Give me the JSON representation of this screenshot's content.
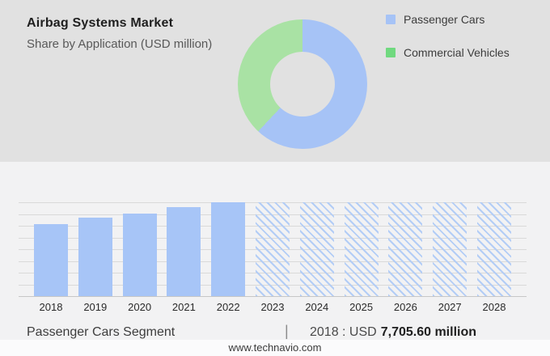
{
  "header": {
    "title": "Airbag Systems Market",
    "subtitle": "Share by Application (USD million)"
  },
  "legend": {
    "items": [
      {
        "label": "Passenger Cars",
        "color": "#a6c3f6"
      },
      {
        "label": "Commercial Vehicles",
        "color": "#70d97f"
      }
    ]
  },
  "footer": {
    "segment_label": "Passenger Cars Segment",
    "divider": "|",
    "value_prefix": "2018 : USD",
    "value_bold": "7,705.60 million",
    "website": "www.technavio.com"
  },
  "colors": {
    "banner_bg": "#e1e1e1",
    "section_bg": "#f2f2f3",
    "bar_blue": "#a7c5f7",
    "hatch_blue": "#b3cdf6",
    "gridline": "#d9d9d9"
  },
  "chart_data": [
    {
      "type": "pie",
      "donut": true,
      "title": "Share by Application (USD million)",
      "labels": [
        "Passenger Cars",
        "Commercial Vehicles"
      ],
      "values": [
        62,
        38
      ],
      "colors": [
        "#a6c3f6",
        "#a9e2a4"
      ],
      "legend_position": "right"
    },
    {
      "type": "bar",
      "categories": [
        "2018",
        "2019",
        "2020",
        "2021",
        "2022",
        "2023",
        "2024",
        "2025",
        "2026",
        "2027",
        "2028"
      ],
      "series": [
        {
          "name": "Passenger Cars segment size (USD million)",
          "values_est": [
            7705.6,
            8398,
            8831,
            9480,
            10043,
            null,
            null,
            null,
            null,
            null,
            null
          ]
        }
      ],
      "bar_relative_heights": [
        0.767,
        0.836,
        0.879,
        0.944,
        1.0,
        1.0,
        1.0,
        1.0,
        1.0,
        1.0,
        1.0
      ],
      "forecast_categories": [
        "2023",
        "2024",
        "2025",
        "2026",
        "2027",
        "2028"
      ],
      "labeled_value": {
        "year": "2018",
        "value_usd_million": 7705.6
      },
      "xlabel": "",
      "ylabel": "",
      "grid": true
    }
  ]
}
